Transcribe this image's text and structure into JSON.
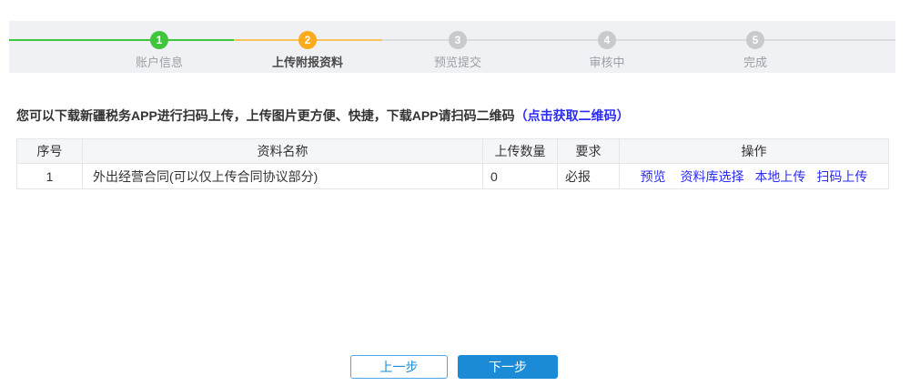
{
  "stepper": {
    "steps": [
      {
        "number": "1",
        "label": "账户信息",
        "state": "done"
      },
      {
        "number": "2",
        "label": "上传附报资料",
        "state": "active"
      },
      {
        "number": "3",
        "label": "预览提交",
        "state": "pending"
      },
      {
        "number": "4",
        "label": "审核中",
        "state": "pending"
      },
      {
        "number": "5",
        "label": "完成",
        "state": "pending"
      }
    ]
  },
  "notice": {
    "text": "您可以下载新疆税务APP进行扫码上传，上传图片更方便、快捷，下载APP请扫码二维码",
    "link": "（点击获取二维码）"
  },
  "table": {
    "headers": [
      "序号",
      "资料名称",
      "上传数量",
      "要求",
      "操作"
    ],
    "rows": [
      {
        "index": "1",
        "name": "外出经营合同(可以仅上传合同协议部分)",
        "count": "0",
        "requirement": "必报",
        "actions": [
          "预览",
          "资料库选择",
          "本地上传",
          "扫码上传"
        ]
      }
    ]
  },
  "footer": {
    "prev_label": "上一步",
    "next_label": "下一步"
  },
  "colors": {
    "step_done_green": "#42c53e",
    "step_active_orange": "#fbab1c",
    "step_pending_gray": "#c8cacd",
    "connector_orange": "#fcc25c",
    "connector_gray": "#dbdcdf",
    "panel_background": "#eff1f4",
    "link_blue": "#2b2bf2",
    "primary_button_blue": "#1b8bd7",
    "table_border": "#e4e6ea",
    "table_header_bg": "#f5f6f8"
  }
}
